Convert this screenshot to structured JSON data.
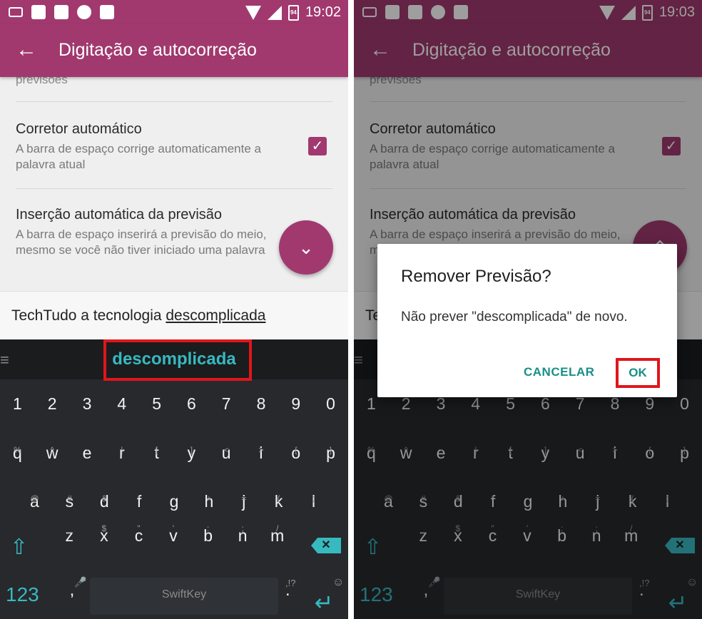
{
  "status_left": {
    "battery": "94",
    "time": "19:02"
  },
  "status_right": {
    "battery": "94",
    "time": "19:03"
  },
  "appbar": {
    "title": "Digitação e autocorreção"
  },
  "settings": {
    "cut_text": "previsões",
    "autocorrect_title": "Corretor automático",
    "autocorrect_sub": "A barra de espaço corrige automaticamente a palavra atual",
    "autoinsert_title": "Inserção automática da previsão",
    "autoinsert_sub": "A barra de espaço inserirá a previsão do meio, mesmo se você não tiver iniciado uma palavra",
    "autocorrect_checked": true
  },
  "typed": {
    "prefix": "TechTudo a tecnologia ",
    "word": "descomplicada"
  },
  "prediction": {
    "word": "descomplicada",
    "menu": "≡"
  },
  "keyboard": {
    "numbers": [
      "1",
      "2",
      "3",
      "4",
      "5",
      "6",
      "7",
      "8",
      "9",
      "0"
    ],
    "row_q": [
      {
        "k": "q",
        "s": "%"
      },
      {
        "k": "w",
        "s": "^"
      },
      {
        "k": "e",
        "s": "~"
      },
      {
        "k": "r",
        "s": "|"
      },
      {
        "k": "t",
        "s": "["
      },
      {
        "k": "y",
        "s": "]"
      },
      {
        "k": "u",
        "s": "<"
      },
      {
        "k": "i",
        "s": ">"
      },
      {
        "k": "o",
        "s": "{"
      },
      {
        "k": "p",
        "s": "}"
      }
    ],
    "row_a": [
      {
        "k": "a",
        "s": "@"
      },
      {
        "k": "s",
        "s": "#"
      },
      {
        "k": "d",
        "s": "&"
      },
      {
        "k": "f",
        "s": "*"
      },
      {
        "k": "g",
        "s": "-"
      },
      {
        "k": "h",
        "s": "+"
      },
      {
        "k": "j",
        "s": "="
      },
      {
        "k": "k",
        "s": "("
      },
      {
        "k": "l",
        "s": ")"
      }
    ],
    "row_z": [
      {
        "k": "z",
        "s": "_"
      },
      {
        "k": "x",
        "s": "$"
      },
      {
        "k": "c",
        "s": "\""
      },
      {
        "k": "v",
        "s": "'"
      },
      {
        "k": "b",
        "s": ":"
      },
      {
        "k": "n",
        "s": ";"
      },
      {
        "k": "m",
        "s": "/"
      }
    ],
    "key_123": "123",
    "comma": ",",
    "period": ".",
    "punct_hint": ",!?",
    "space_logo": "SwiftKey",
    "backspace": "✕"
  },
  "dialog": {
    "title": "Remover Previsão?",
    "message": "Não prever \"descomplicada\" de novo.",
    "cancel": "CANCELAR",
    "ok": "OK"
  },
  "colors": {
    "brand": "#a1396f",
    "accent": "#37b9c0",
    "highlight": "#e0161b",
    "dialog_button": "#178f87"
  }
}
